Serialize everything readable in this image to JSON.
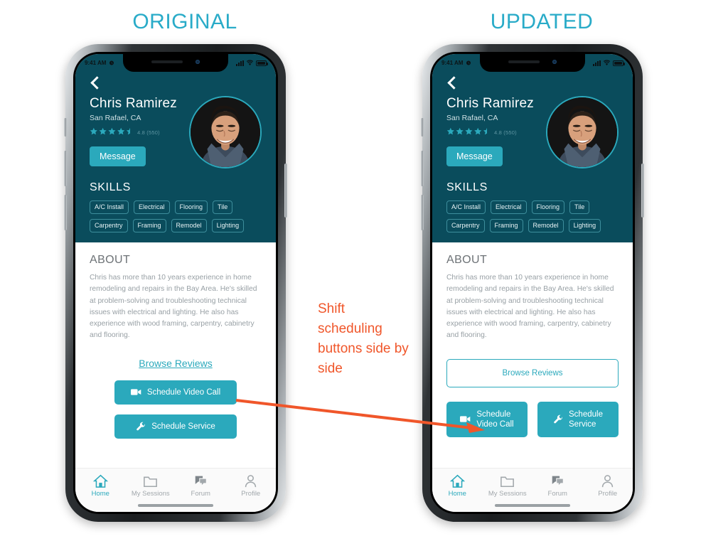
{
  "columns": {
    "original_title": "ORIGINAL",
    "updated_title": "UPDATED"
  },
  "annotation": {
    "text": "Shift scheduling buttons side by side",
    "color": "#F0562A",
    "arrow": "arrow-pointing-right"
  },
  "theme": {
    "header_bg": "#0A4C5C",
    "accent": "#2BA9BC",
    "title_color": "#29ABC8",
    "annotation_color": "#F0562A"
  },
  "status_bar": {
    "time": "9:41 AM",
    "icons": [
      "alarm-icon",
      "cellular-signal-icon",
      "wifi-icon",
      "battery-icon"
    ]
  },
  "profile": {
    "back_icon": "chevron-left-icon",
    "name": "Chris Ramirez",
    "location": "San Rafael, CA",
    "stars": "★★★★",
    "half_star": "½",
    "rating_text": "4.8 (550)",
    "message_label": "Message",
    "avatar_alt": "profile-photo"
  },
  "skills": {
    "heading": "SKILLS",
    "tags": [
      "A/C Install",
      "Electrical",
      "Flooring",
      "Tile",
      "Carpentry",
      "Framing",
      "Remodel",
      "Lighting"
    ]
  },
  "about": {
    "heading": "ABOUT",
    "body": "Chris has more than 10 years experience in home remodeling and repairs in the Bay Area.  He's skilled at problem-solving and troubleshooting technical issues with electrical and lighting. He also has experience with wood framing, carpentry, cabinetry and flooring."
  },
  "actions": {
    "browse_reviews": "Browse Reviews",
    "video_call": "Schedule Video Call",
    "video_call_l1": "Schedule",
    "video_call_l2": "Video Call",
    "service": "Schedule Service",
    "service_l1": "Schedule",
    "service_l2": "Service",
    "video_icon": "video-camera-icon",
    "service_icon": "wrench-icon"
  },
  "tabbar": {
    "items": [
      {
        "label": "Home",
        "icon": "home-icon",
        "active": true
      },
      {
        "label": "My Sessions",
        "icon": "folder-icon",
        "active": false
      },
      {
        "label": "Forum",
        "icon": "chat-bubbles-icon",
        "active": false
      },
      {
        "label": "Profile",
        "icon": "person-icon",
        "active": false
      }
    ]
  }
}
